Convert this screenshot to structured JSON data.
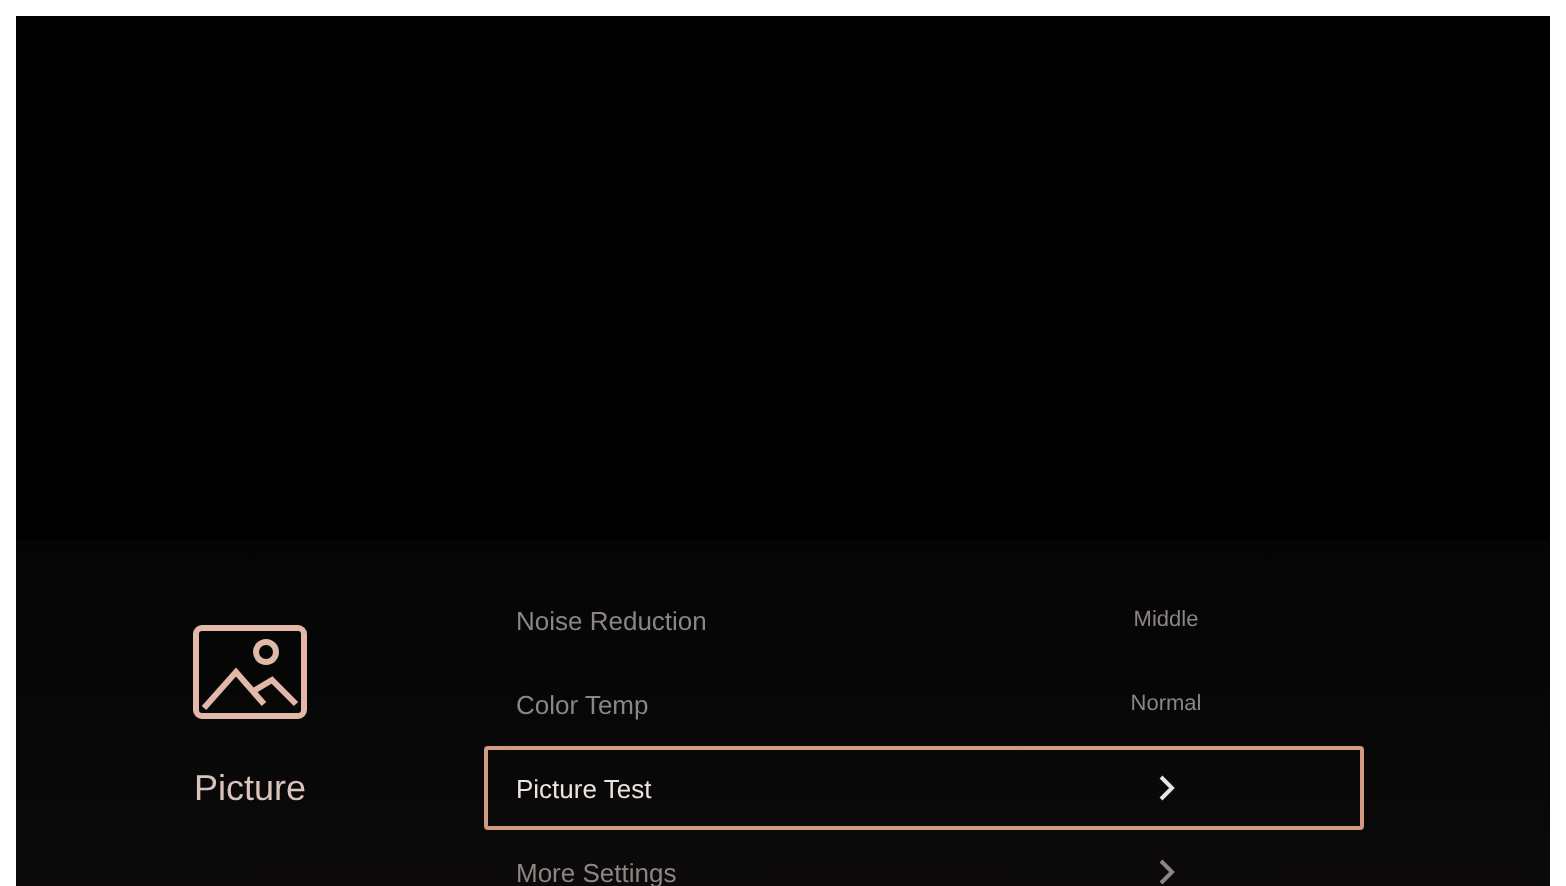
{
  "category": {
    "label": "Picture"
  },
  "menu": [
    {
      "label": "Noise Reduction",
      "kind": "value",
      "value": "Middle",
      "selected": false
    },
    {
      "label": "Color Temp",
      "kind": "value",
      "value": "Normal",
      "selected": false
    },
    {
      "label": "Picture Test",
      "kind": "submenu",
      "selected": true
    },
    {
      "label": "More Settings",
      "kind": "submenu",
      "selected": false
    }
  ]
}
